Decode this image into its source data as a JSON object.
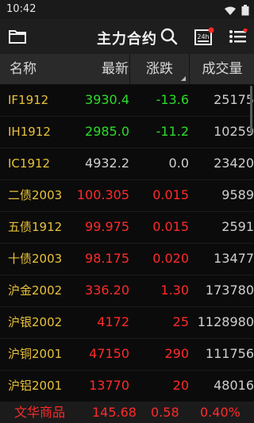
{
  "status_bar": {
    "time": "10:42"
  },
  "app_bar": {
    "title": "主力合约"
  },
  "table": {
    "columns": [
      "名称",
      "最新",
      "涨跌",
      "成交量"
    ],
    "rows": [
      {
        "name": "IF1912",
        "price": "3930.4",
        "change": "-13.6",
        "volume": "25175",
        "trend": "down"
      },
      {
        "name": "IH1912",
        "price": "2985.0",
        "change": "-11.2",
        "volume": "10259",
        "trend": "down"
      },
      {
        "name": "IC1912",
        "price": "4932.2",
        "change": "0.0",
        "volume": "23420",
        "trend": "flat"
      },
      {
        "name": "二债2003",
        "price": "100.305",
        "change": "0.015",
        "volume": "9589",
        "trend": "up"
      },
      {
        "name": "五债1912",
        "price": "99.975",
        "change": "0.015",
        "volume": "2591",
        "trend": "up"
      },
      {
        "name": "十债2003",
        "price": "98.175",
        "change": "0.020",
        "volume": "13477",
        "trend": "up"
      },
      {
        "name": "沪金2002",
        "price": "336.20",
        "change": "1.30",
        "volume": "173780",
        "trend": "up"
      },
      {
        "name": "沪银2002",
        "price": "4172",
        "change": "25",
        "volume": "1128980",
        "trend": "up"
      },
      {
        "name": "沪铜2001",
        "price": "47150",
        "change": "290",
        "volume": "111756",
        "trend": "up"
      },
      {
        "name": "沪铝2001",
        "price": "13770",
        "change": "20",
        "volume": "48016",
        "trend": "up"
      }
    ]
  },
  "footer": {
    "index_name": "文华商品",
    "value": "145.68",
    "change": "0.58",
    "percent": "0.40%"
  },
  "colors": {
    "up": "#ff2a2a",
    "down": "#2ddc2d",
    "name": "#e8c13a"
  },
  "icons": [
    "folder-icon",
    "search-icon",
    "24h-news-icon",
    "menu-list-icon",
    "wifi-icon",
    "battery-icon"
  ]
}
